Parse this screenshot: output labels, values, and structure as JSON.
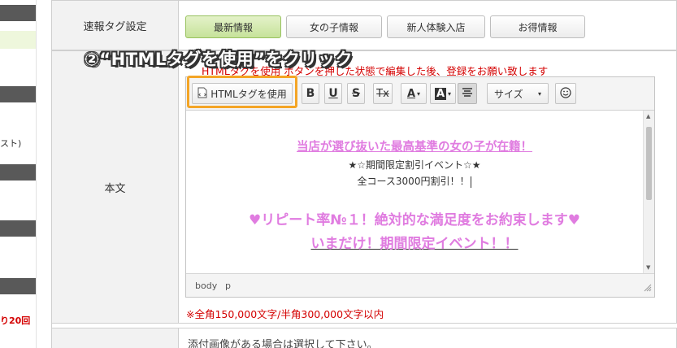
{
  "sidebar": {
    "text_fragment": "スト)",
    "red_fragment": "り20回"
  },
  "form": {
    "tag_label": "速報タグ設定",
    "tags": [
      {
        "label": "最新情報",
        "active": true
      },
      {
        "label": "女の子情報",
        "active": false
      },
      {
        "label": "新人体験入店",
        "active": false
      },
      {
        "label": "お得情報",
        "active": false
      }
    ],
    "body_label": "本文",
    "instruction_note": "HTMLタグを使用 ボタンを押した状態で編集した後、登録をお願い致します",
    "limit_note": "※全角150,000文字/半角300,000文字以内",
    "attach_note": "添付画像がある場合は選択して下さい。"
  },
  "annotation": "②“HTMLタグを使用”をクリック",
  "editor": {
    "html_button": "HTMLタグを使用",
    "bold": "B",
    "underline": "U",
    "strike": "S",
    "clear_format": "Tx",
    "text_color": "A",
    "bg_color": "A",
    "size_label": "サイズ",
    "content": {
      "line1": "当店が選び抜いた最高基準の女の子が在籍！",
      "line2": "★☆期間限定割引イベント☆★",
      "line3": "全コース3000円割引！！",
      "line4": "♥リピート率№１！絶対的な満足度をお約束します♥",
      "line5": "いまだけ！期間限定イベント！！"
    },
    "path": [
      "body",
      "p"
    ]
  },
  "colors": {
    "annotation_highlight": "#f4a526",
    "active_tag": "#c6e29a",
    "pink_text": "#e07ce0",
    "red_note": "#d40000"
  }
}
